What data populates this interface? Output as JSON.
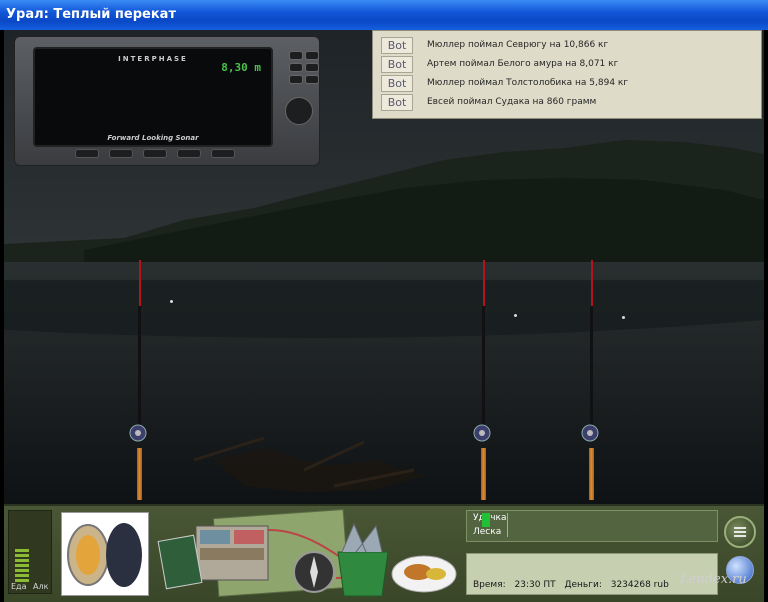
{
  "window": {
    "title": "Урал: Теплый перекат"
  },
  "sonar": {
    "brand": "INTERPHASE",
    "depth": "8,30 m",
    "footer": "Forward Looking Sonar"
  },
  "chat": {
    "messages": [
      {
        "tag": "Bot",
        "text": "Мюллер поймал Севрюгу на 10,866 кг"
      },
      {
        "tag": "Bot",
        "text": "Артем поймал Белого амура на 8,071 кг"
      },
      {
        "tag": "Bot",
        "text": "Мюллер поймал Толстолобика на 5,894 кг"
      },
      {
        "tag": "Bot",
        "text": "Евсей поймал Судака на 860 грамм"
      }
    ]
  },
  "panel": {
    "food_label": "Еда",
    "alc_label": "Алк",
    "info": {
      "rod_label": "Удочка",
      "line_label": "Леска"
    },
    "status": {
      "time_label": "Время:",
      "time_value": "23:30 ПТ",
      "money_label": "Деньги:",
      "money_value": "3234268 rub"
    }
  },
  "watermark": "Lendex.ru",
  "colors": {
    "titlebar": "#0a48c6",
    "rod_tip": "#b1141a",
    "handle": "#dd8e35",
    "panel": "#495736"
  }
}
